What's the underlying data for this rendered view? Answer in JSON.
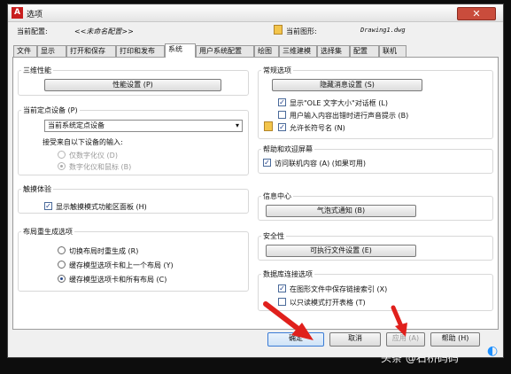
{
  "window": {
    "title": "选项",
    "close_glyph": "✕",
    "profile_label": "当前配置:",
    "profile_value": "<<未命名配置>>",
    "drawing_label": "当前图形:",
    "drawing_value": "Drawing1.dwg"
  },
  "tabs": [
    {
      "label": "文件"
    },
    {
      "label": "显示"
    },
    {
      "label": "打开和保存"
    },
    {
      "label": "打印和发布"
    },
    {
      "label": "系统",
      "active": true
    },
    {
      "label": "用户系统配置"
    },
    {
      "label": "绘图"
    },
    {
      "label": "三维建模"
    },
    {
      "label": "选择集"
    },
    {
      "label": "配置"
    },
    {
      "label": "联机"
    }
  ],
  "groups": {
    "perf": {
      "title": "三维性能",
      "button": "性能设置 (P)"
    },
    "pointing": {
      "title": "当前定点设备 (P)",
      "select_value": "当前系统定点设备",
      "accept_label": "接受来自以下设备的输入:",
      "options": [
        {
          "label": "仅数字化仪 (D)",
          "selected": false
        },
        {
          "label": "数字化仪和鼠标 (B)",
          "selected": true
        }
      ]
    },
    "touch": {
      "title": "触摸体验",
      "checkbox_label": "显示触摸模式功能区面板 (H)",
      "checked": true
    },
    "layout": {
      "title": "布局重生成选项",
      "options": [
        {
          "label": "切换布局时重生成 (R)",
          "selected": false
        },
        {
          "label": "缓存模型选项卡和上一个布局 (Y)",
          "selected": false
        },
        {
          "label": "缓存模型选项卡和所有布局 (C)",
          "selected": true
        }
      ]
    },
    "general": {
      "title": "常规选项",
      "button": "隐藏消息设置 (S)",
      "checks": [
        {
          "label": "显示\"OLE 文字大小\"对话框 (L)",
          "checked": true
        },
        {
          "label": "用户输入内容出错时进行声音提示 (B)",
          "checked": false
        },
        {
          "label": "允许长符号名 (N)",
          "checked": true
        }
      ]
    },
    "help": {
      "title": "帮助和欢迎屏幕",
      "checkbox_label": "访问联机内容 (A) (如果可用)",
      "checked": true
    },
    "info": {
      "title": "信息中心",
      "button": "气泡式通知 (B)"
    },
    "security": {
      "title": "安全性",
      "button": "可执行文件设置 (E)"
    },
    "db": {
      "title": "数据库连接选项",
      "checks": [
        {
          "label": "在图形文件中保存链接索引 (X)",
          "checked": true
        },
        {
          "label": "以只读模式打开表格 (T)",
          "checked": false
        }
      ]
    }
  },
  "footer": {
    "ok": "确定",
    "cancel": "取消",
    "apply": "应用 (A)",
    "help": "帮助 (H)"
  },
  "overlay": {
    "watermark": "头条 @石桥码码",
    "check_mark": "✓",
    "select_arrow": "▾"
  },
  "colors": {
    "arrow": "#e0201c",
    "accent": "#3a7bd5"
  }
}
